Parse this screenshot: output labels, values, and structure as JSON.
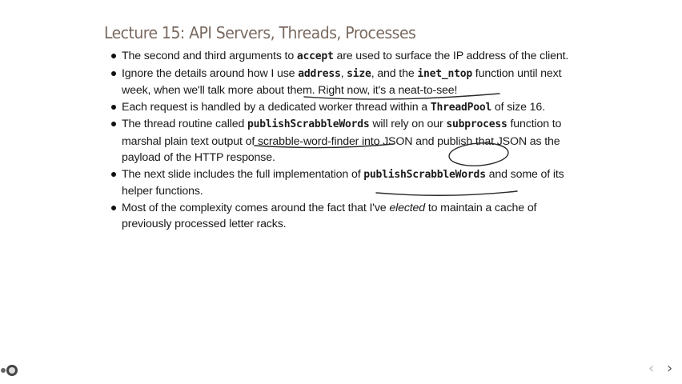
{
  "slide": {
    "title": "Lecture 15: API Servers, Threads, Processes",
    "bullets": [
      {
        "segments": [
          {
            "text": "The second and third arguments to ",
            "style": "plain"
          },
          {
            "text": "accept",
            "style": "code"
          },
          {
            "text": " are used to surface the IP address of the client.",
            "style": "plain"
          }
        ]
      },
      {
        "segments": [
          {
            "text": "Ignore the details around how I use ",
            "style": "plain"
          },
          {
            "text": "address",
            "style": "code"
          },
          {
            "text": ", ",
            "style": "plain"
          },
          {
            "text": "size",
            "style": "code"
          },
          {
            "text": ", and the ",
            "style": "plain"
          },
          {
            "text": "inet_ntop",
            "style": "code"
          },
          {
            "text": " function until next week, when we'll talk more about them. Right now, it's a neat-to-see!",
            "style": "plain"
          }
        ]
      },
      {
        "segments": [
          {
            "text": "Each request is handled by a dedicated worker thread within a ",
            "style": "plain"
          },
          {
            "text": "ThreadPool",
            "style": "code"
          },
          {
            "text": " of size 16.",
            "style": "plain"
          }
        ]
      },
      {
        "segments": [
          {
            "text": "The thread routine called ",
            "style": "plain"
          },
          {
            "text": "publishScrabbleWords",
            "style": "code"
          },
          {
            "text": " will rely on our ",
            "style": "plain"
          },
          {
            "text": "subprocess",
            "style": "code"
          },
          {
            "text": " function to marshal plain text output of scrabble-word-finder into JSON and publish that JSON as the payload of the HTTP response.",
            "style": "plain"
          }
        ]
      },
      {
        "segments": [
          {
            "text": "The next slide includes the full implementation of ",
            "style": "plain"
          },
          {
            "text": "publishScrabbleWords",
            "style": "code"
          },
          {
            "text": " and some of its helper functions.",
            "style": "plain"
          }
        ]
      },
      {
        "segments": [
          {
            "text": "Most of the complexity comes around the fact that I've ",
            "style": "plain"
          },
          {
            "text": "elected",
            "style": "em"
          },
          {
            "text": " to maintain a cache of previously processed letter racks.",
            "style": "plain"
          }
        ]
      }
    ]
  },
  "annotations": {
    "ink_color": "#2a2a2a",
    "items": [
      "underline-address-size-inet-ntop",
      "underline-publishScrabbleWords",
      "circle-json",
      "underline-publishScrabbleWords-2"
    ]
  },
  "navigation": {
    "prev_icon": "chevron-left-icon",
    "next_icon": "chevron-right-icon",
    "prev_glyph": "‹",
    "next_glyph": "›"
  },
  "corner": {
    "icon": "presenter-avatar-icon"
  }
}
